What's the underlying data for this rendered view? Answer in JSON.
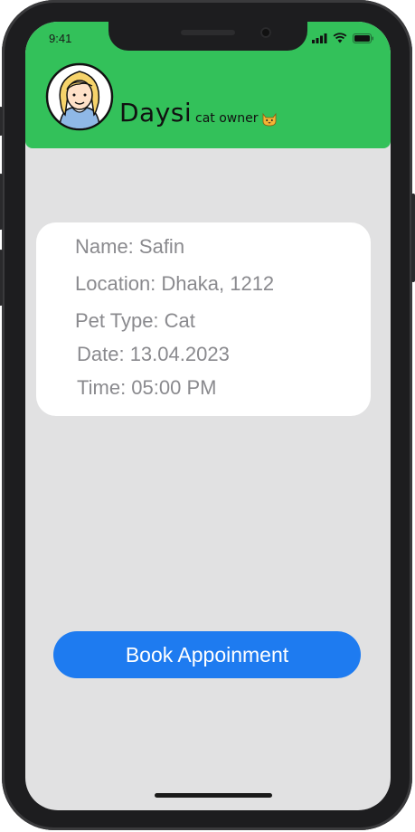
{
  "status_bar": {
    "time": "9:41",
    "icons": [
      "signal-icon",
      "wifi-icon",
      "battery-icon"
    ]
  },
  "header": {
    "user_name": "Daysi",
    "user_role": "cat owner",
    "role_icon": "cat-face-icon",
    "avatar_icon": "woman-avatar-icon",
    "background_color": "#33c15a"
  },
  "appointment_card": {
    "name": "Name: Safin",
    "location": "Location: Dhaka, 1212",
    "pet_type": "Pet Type: Cat",
    "date": "Date: 13.04.2023",
    "time": "Time: 05:00 PM"
  },
  "actions": {
    "book_label": "Book Appoinment",
    "book_color": "#1e7bf0"
  }
}
